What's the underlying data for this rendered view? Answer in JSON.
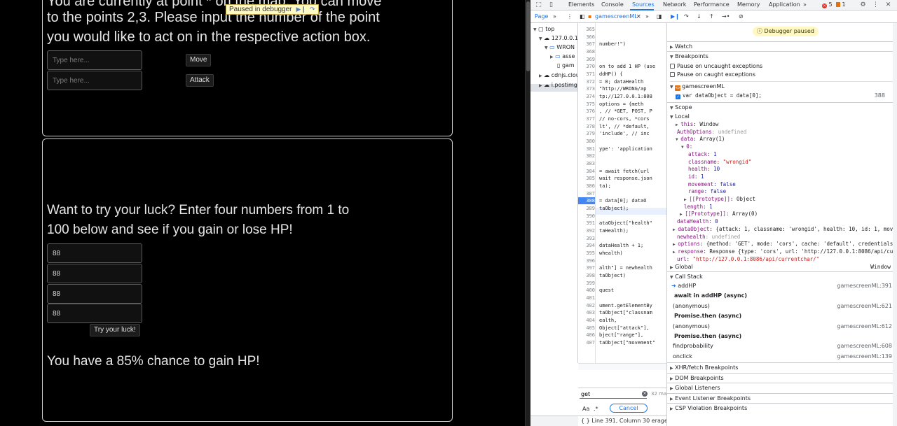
{
  "game": {
    "top_text_line1": "You are currently at point * on the map. You can move",
    "top_text_line2": "to the points 2,3. Please input the number of the point",
    "top_text_line3": "you would like to act on in the respective action box.",
    "move_input_placeholder": "Type here...",
    "move_button": "Move",
    "attack_input_placeholder": "Type here...",
    "attack_button": "Attack",
    "luck_line1": "Want to try your luck? Enter four numbers from 1 to",
    "luck_line2": "100 below and see if you gain or lose HP!",
    "luck_inputs": [
      "88",
      "88",
      "88",
      "88"
    ],
    "try_button": "Try your luck!",
    "chance_text": "You have a 85% chance to gain HP!",
    "paused_badge": "Paused in debugger"
  },
  "devtools": {
    "tabs": [
      "Elements",
      "Console",
      "Sources",
      "Network",
      "Performance",
      "Memory",
      "Application"
    ],
    "active_tab": "Sources",
    "error_count": "5",
    "warning_count": "1",
    "page_label": "Page",
    "file_tab": "gamescreenML",
    "navigator": {
      "top": "top",
      "host": "127.0.0.1:",
      "folder": "WRON",
      "assets": "asse",
      "file": "gam",
      "cdn": "cdnjs.clou",
      "img": "i.postimg"
    },
    "code_lines": [
      {
        "n": "365",
        "t": ""
      },
      {
        "n": "366",
        "t": ""
      },
      {
        "n": "367",
        "t": " number!\")"
      },
      {
        "n": "368",
        "t": ""
      },
      {
        "n": "369",
        "t": ""
      },
      {
        "n": "370",
        "t": "on to add 1 HP (use"
      },
      {
        "n": "371",
        "t": "ddHP() {"
      },
      {
        "n": "372",
        "t": " = 0;  dataHealth"
      },
      {
        "n": "373",
        "t": " \"http://WRONG/ap"
      },
      {
        "n": "374",
        "t": "tp://127.0.0.1:808"
      },
      {
        "n": "375",
        "t": "  options = {meth"
      },
      {
        "n": "376",
        "t": ", // *GET, POST, P"
      },
      {
        "n": "377",
        "t": " // no-cors, *cors"
      },
      {
        "n": "378",
        "t": "lt', // *default,"
      },
      {
        "n": "379",
        "t": " 'include', // inc"
      },
      {
        "n": "380",
        "t": ""
      },
      {
        "n": "381",
        "t": "ype': 'application"
      },
      {
        "n": "382",
        "t": ""
      },
      {
        "n": "383",
        "t": ""
      },
      {
        "n": "384",
        "t": " = await fetch(url"
      },
      {
        "n": "385",
        "t": "wait response.json"
      },
      {
        "n": "386",
        "t": "ta);"
      },
      {
        "n": "387",
        "t": ""
      },
      {
        "n": "388",
        "t": " = data[0];  dataO"
      },
      {
        "n": "389",
        "t": "taObject);"
      },
      {
        "n": "390",
        "t": ""
      },
      {
        "n": "391",
        "t": "ataObject[\"health\""
      },
      {
        "n": "392",
        "t": "taHealth);"
      },
      {
        "n": "393",
        "t": ""
      },
      {
        "n": "394",
        "t": " dataHealth + 1;"
      },
      {
        "n": "395",
        "t": "whealth)"
      },
      {
        "n": "396",
        "t": ""
      },
      {
        "n": "397",
        "t": "alth\"] = newhealth"
      },
      {
        "n": "398",
        "t": "taObject)"
      },
      {
        "n": "399",
        "t": ""
      },
      {
        "n": "400",
        "t": "quest"
      },
      {
        "n": "401",
        "t": ""
      },
      {
        "n": "402",
        "t": "ument.getElementBy"
      },
      {
        "n": "403",
        "t": "taObject[\"classnam"
      },
      {
        "n": "404",
        "t": "ealth,"
      },
      {
        "n": "405",
        "t": "Object[\"attack\"],"
      },
      {
        "n": "406",
        "t": "bject[\"range\"],"
      },
      {
        "n": "407",
        "t": "taObject[\"movement\""
      }
    ],
    "search_value": "get",
    "search_count": "32 ma",
    "cancel_label": "Cancel",
    "case_label": "Aa",
    "regex_label": ".*",
    "status_text": "Line 391, Column 30  erage:",
    "paused_banner": "Debugger paused",
    "sections": {
      "watch": "Watch",
      "breakpoints": "Breakpoints",
      "pause_uncaught": "Pause on uncaught exceptions",
      "pause_caught": "Pause on caught exceptions",
      "bp_file": "gamescreenML",
      "bp_code": "var dataObject = data[0];",
      "bp_line": "388",
      "scope": "Scope",
      "local": "Local",
      "global": "Global",
      "global_value": "Window",
      "call_stack": "Call Stack",
      "xhr": "XHR/fetch Breakpoints",
      "dom": "DOM Breakpoints",
      "listeners": "Global Listeners",
      "event_bp": "Event Listener Breakpoints",
      "csp": "CSP Violation Breakpoints"
    },
    "scope_lines": [
      "this: Window",
      "AuthOptions: undefined",
      "data: Array(1)",
      "0:",
      "attack: 1",
      "classname: \"wrongid\"",
      "health: 10",
      "id: 1",
      "movement: false",
      "range: false",
      "[[Prototype]]: Object",
      "length: 1",
      "[[Prototype]]: Array(0)",
      "dataHealth: 0",
      "dataObject: {attack: 1, classname: 'wrongid', health: 10, id: 1, moveme",
      "newhealth: undefined",
      "options: {method: 'GET', mode: 'cors', cache: 'default', credentials: '",
      "response: Response {type: 'cors', url: 'http://127.0.0.1:8086/api/curre",
      "url: \"http://127.0.0.1:8086/api/currentchar/\""
    ],
    "call_stack": [
      {
        "name": "addHP",
        "loc": "gamescreenML:391",
        "type": "frame"
      },
      {
        "name": "await in addHP (async)",
        "loc": "",
        "type": "async"
      },
      {
        "name": "(anonymous)",
        "loc": "gamescreenML:621",
        "type": "frame"
      },
      {
        "name": "Promise.then (async)",
        "loc": "",
        "type": "async"
      },
      {
        "name": "(anonymous)",
        "loc": "gamescreenML:612",
        "type": "frame"
      },
      {
        "name": "Promise.then (async)",
        "loc": "",
        "type": "async"
      },
      {
        "name": "findprobability",
        "loc": "gamescreenML:608",
        "type": "frame"
      },
      {
        "name": "onclick",
        "loc": "gamescreenML:139",
        "type": "frame"
      }
    ]
  }
}
